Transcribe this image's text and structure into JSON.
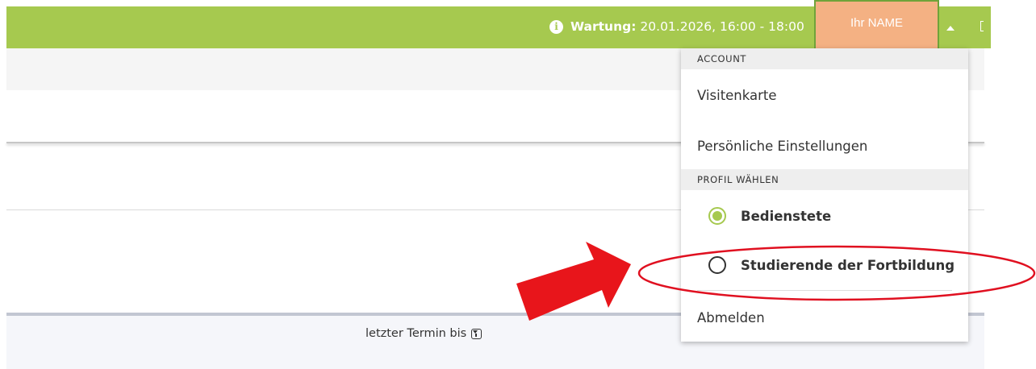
{
  "topbar": {
    "notice_label": "Wartung:",
    "notice_text": "20.01.2026, 16:00 - 18:00",
    "user_name": "Ihr NAME",
    "info_glyph": "i"
  },
  "table": {
    "column_header": "letzter Termin bis"
  },
  "menu": {
    "account_header": "ACCOUNT",
    "items": [
      {
        "label": "Visitenkarte"
      },
      {
        "label": "Persönliche Einstellungen"
      }
    ],
    "profile_header": "PROFIL WÄHLEN",
    "profiles": [
      {
        "label": "Bedienstete",
        "selected": true
      },
      {
        "label": "Studierende der Fortbildung",
        "selected": false
      }
    ],
    "logout": "Abmelden"
  },
  "colors": {
    "accent_green": "#a6c94f",
    "highlight_box": "#f4b183",
    "annotation_red": "#e8151b"
  }
}
